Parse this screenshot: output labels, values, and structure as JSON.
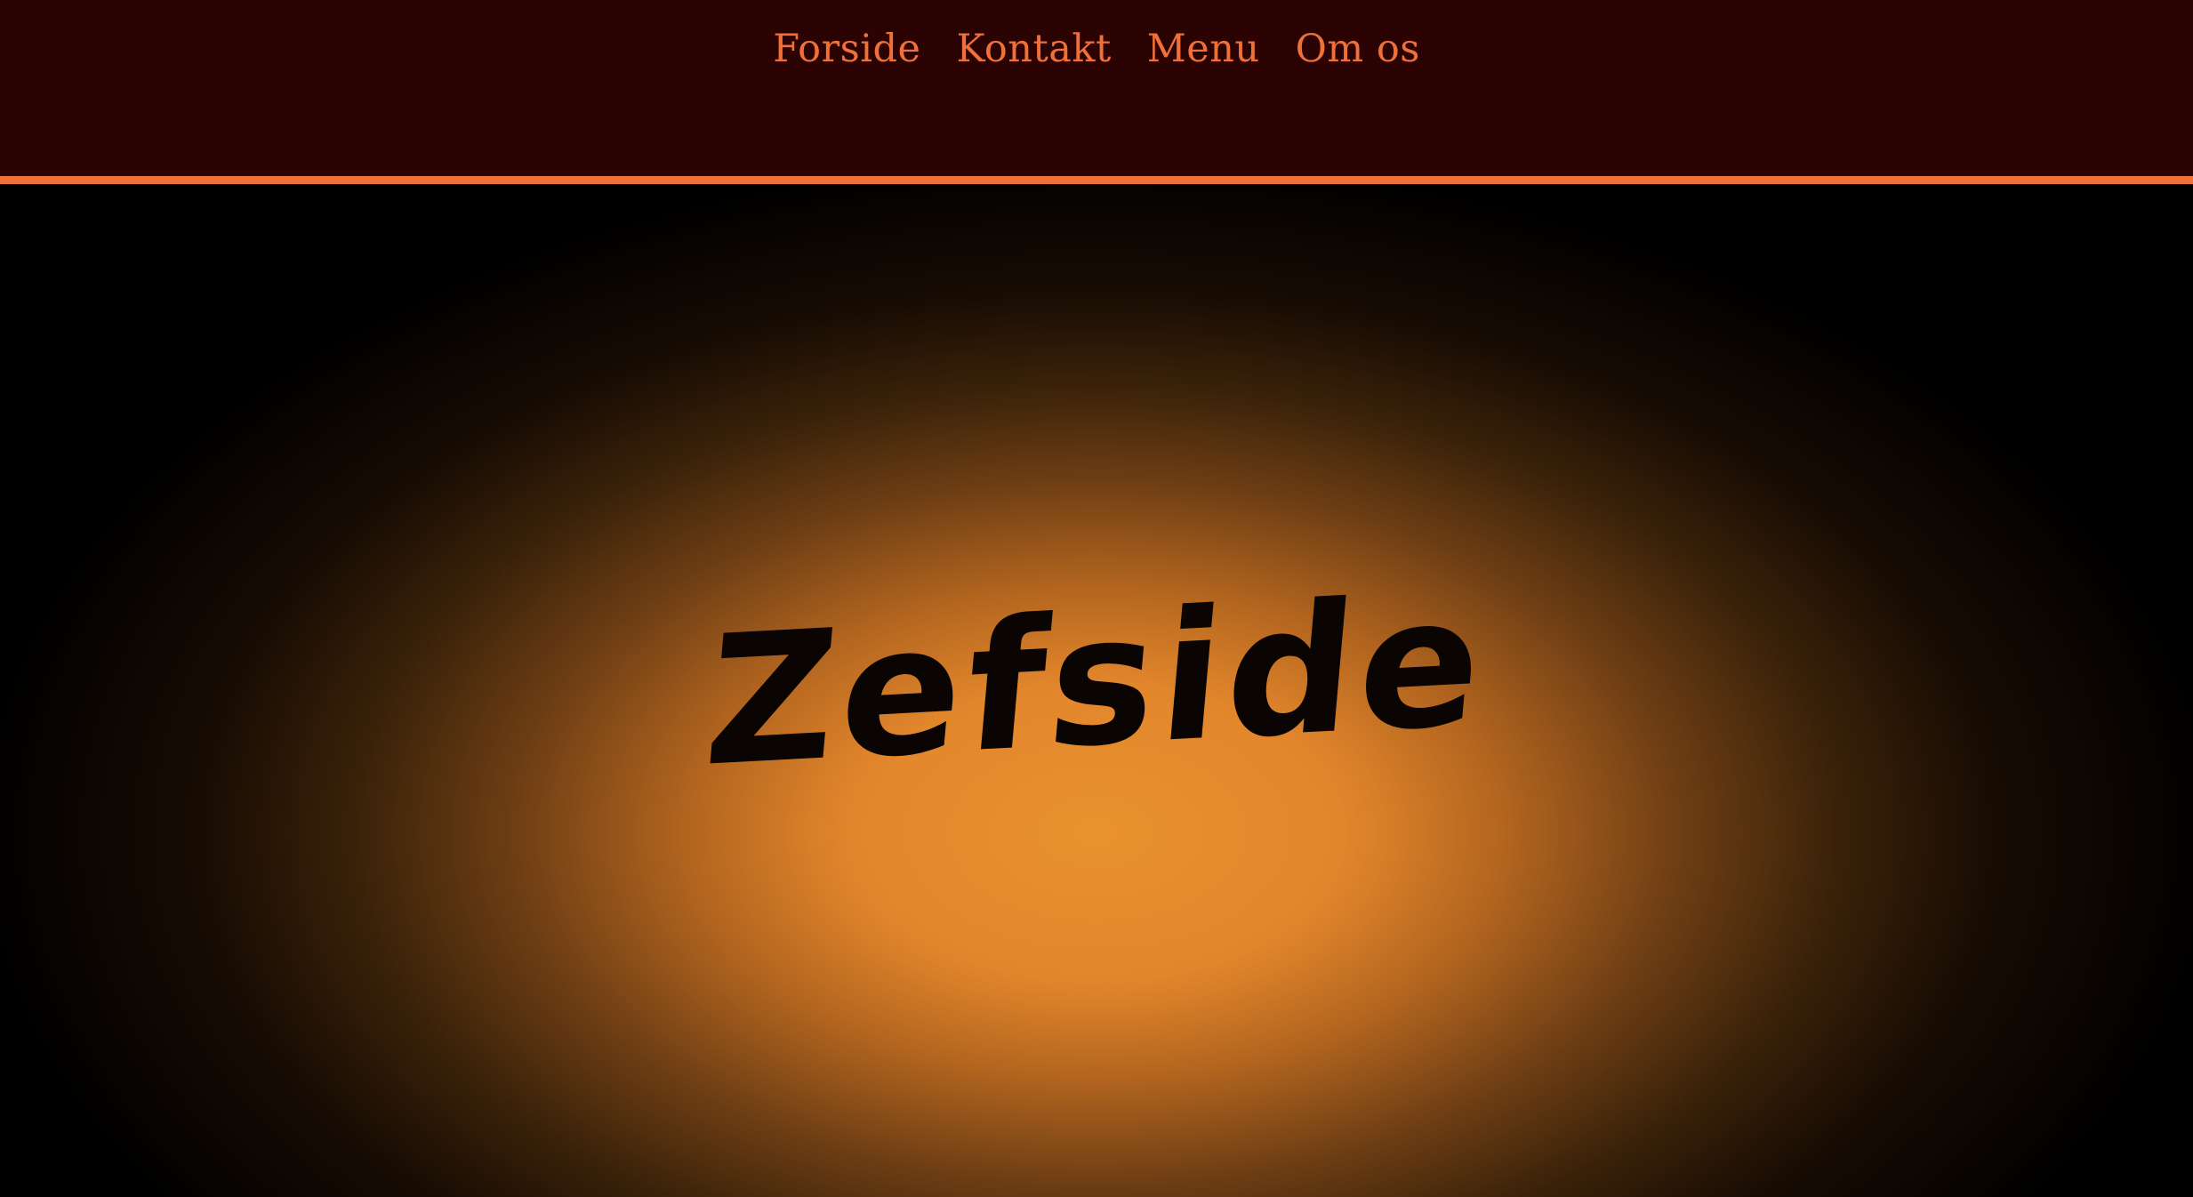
{
  "nav": {
    "items": [
      {
        "label": "Forside"
      },
      {
        "label": "Kontakt"
      },
      {
        "label": "Menu"
      },
      {
        "label": "Om os"
      }
    ]
  },
  "hero": {
    "title": "Zefside"
  },
  "colors": {
    "header_bg": "#2a0302",
    "accent": "#f0703a",
    "hero_glow": "#e8922e",
    "page_bg": "#000000"
  }
}
